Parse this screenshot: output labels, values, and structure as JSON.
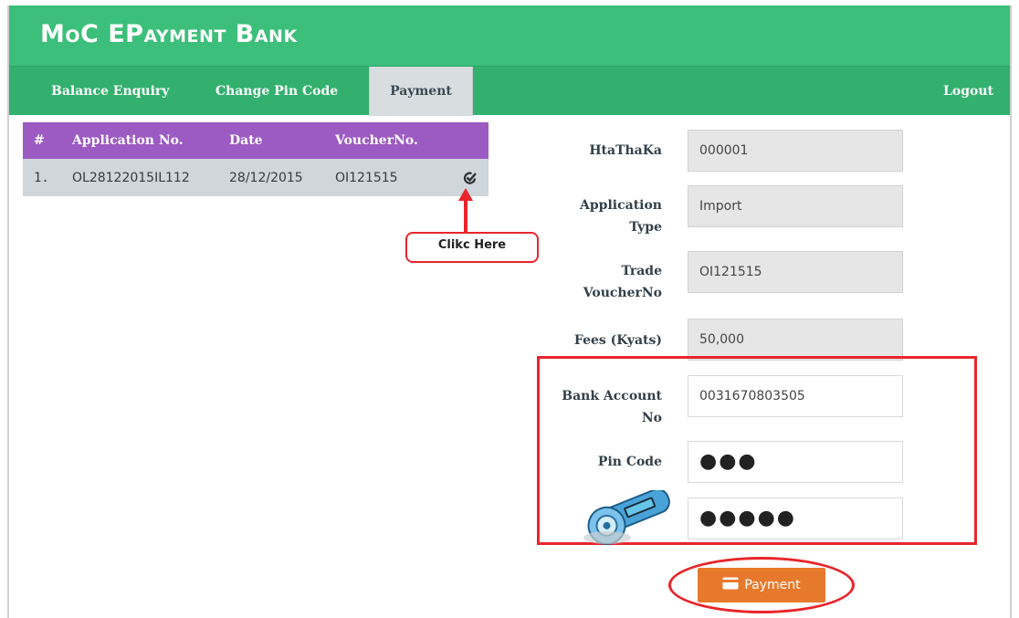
{
  "app": {
    "title": "MoC EPayment Bank"
  },
  "nav": {
    "items": [
      "Balance Enquiry",
      "Change Pin Code",
      "Payment"
    ],
    "active": "Payment",
    "logout": "Logout"
  },
  "table": {
    "headers": [
      "#",
      "Application No.",
      "Date",
      "VoucherNo."
    ],
    "rows": [
      {
        "num": "1.",
        "application_no": "OL28122015IL112",
        "date": "28/12/2015",
        "voucher_no": "OI121515",
        "action_icon": "check-select-icon"
      }
    ]
  },
  "annotation": {
    "callout": "Clikc Here",
    "color": "#e8252b"
  },
  "form": {
    "htathaka": {
      "label": "HtaThaKa",
      "value": "000001"
    },
    "application_type": {
      "label_line1": "Application",
      "label_line2": "Type",
      "value": "Import"
    },
    "trade_voucher": {
      "label_line1": "Trade",
      "label_line2": "VoucherNo",
      "value": "OI121515"
    },
    "fees": {
      "label": "Fees (Kyats)",
      "value": "50,000"
    },
    "bank_account": {
      "label_line1": "Bank Account",
      "label_line2": "No",
      "value": "0031670803505"
    },
    "pin_code": {
      "label": "Pin Code",
      "value": "●●●"
    },
    "token": {
      "icon": "security-token-icon",
      "value": "●●●●●"
    }
  },
  "payment_button": {
    "label": "Payment",
    "icon": "credit-card-icon"
  },
  "colors": {
    "header": "#3cbf7a",
    "navbar": "#33b06e",
    "table_header": "#9c5bc2",
    "button": "#e7792d",
    "highlight": "#e8252b"
  }
}
